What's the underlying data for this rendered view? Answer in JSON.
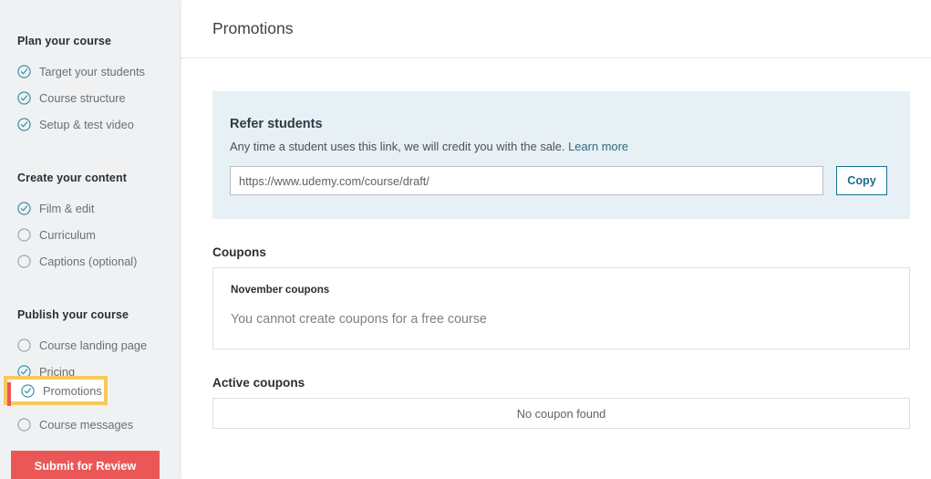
{
  "colors": {
    "sidebar_bg": "#f0f1f2",
    "panel_bg": "#e7f0f5",
    "accent_teal": "#1f6e8c",
    "submit_red": "#eb5757",
    "highlight_yellow": "#f7c95c",
    "indicator_red": "#eb5757",
    "checked_circle": "#2a8ba8",
    "unchecked_circle": "#9aa0a6"
  },
  "sidebar": {
    "sections": [
      {
        "heading": "Plan your course",
        "items": [
          {
            "label": "Target your students",
            "icon": "check-circle-icon",
            "checked": true
          },
          {
            "label": "Course structure",
            "icon": "check-circle-icon",
            "checked": true
          },
          {
            "label": "Setup & test video",
            "icon": "check-circle-icon",
            "checked": true
          }
        ]
      },
      {
        "heading": "Create your content",
        "items": [
          {
            "label": "Film & edit",
            "icon": "check-circle-icon",
            "checked": true
          },
          {
            "label": "Curriculum",
            "icon": "empty-circle-icon",
            "checked": false
          },
          {
            "label": "Captions (optional)",
            "icon": "empty-circle-icon",
            "checked": false
          }
        ]
      },
      {
        "heading": "Publish your course",
        "items": [
          {
            "label": "Course landing page",
            "icon": "empty-circle-icon",
            "checked": false
          },
          {
            "label": "Pricing",
            "icon": "check-circle-icon",
            "checked": true
          },
          {
            "label": "Promotions",
            "icon": "check-circle-icon",
            "checked": true,
            "active": true
          },
          {
            "label": "Course messages",
            "icon": "empty-circle-icon",
            "checked": false
          }
        ]
      }
    ],
    "submit_label": "Submit for Review"
  },
  "header": {
    "title": "Promotions"
  },
  "refer": {
    "title": "Refer students",
    "description": "Any time a student uses this link, we will credit you with the sale.",
    "learn_more": "Learn more",
    "link_value": "https://www.udemy.com/course/draft/",
    "link_placeholder": "https://www.udemy.com/course/draft/",
    "copy_label": "Copy"
  },
  "coupons": {
    "section_title": "Coupons",
    "card_label": "November coupons",
    "card_message": "You cannot create coupons for a free course"
  },
  "active_coupons": {
    "section_title": "Active coupons",
    "empty_message": "No coupon found"
  }
}
